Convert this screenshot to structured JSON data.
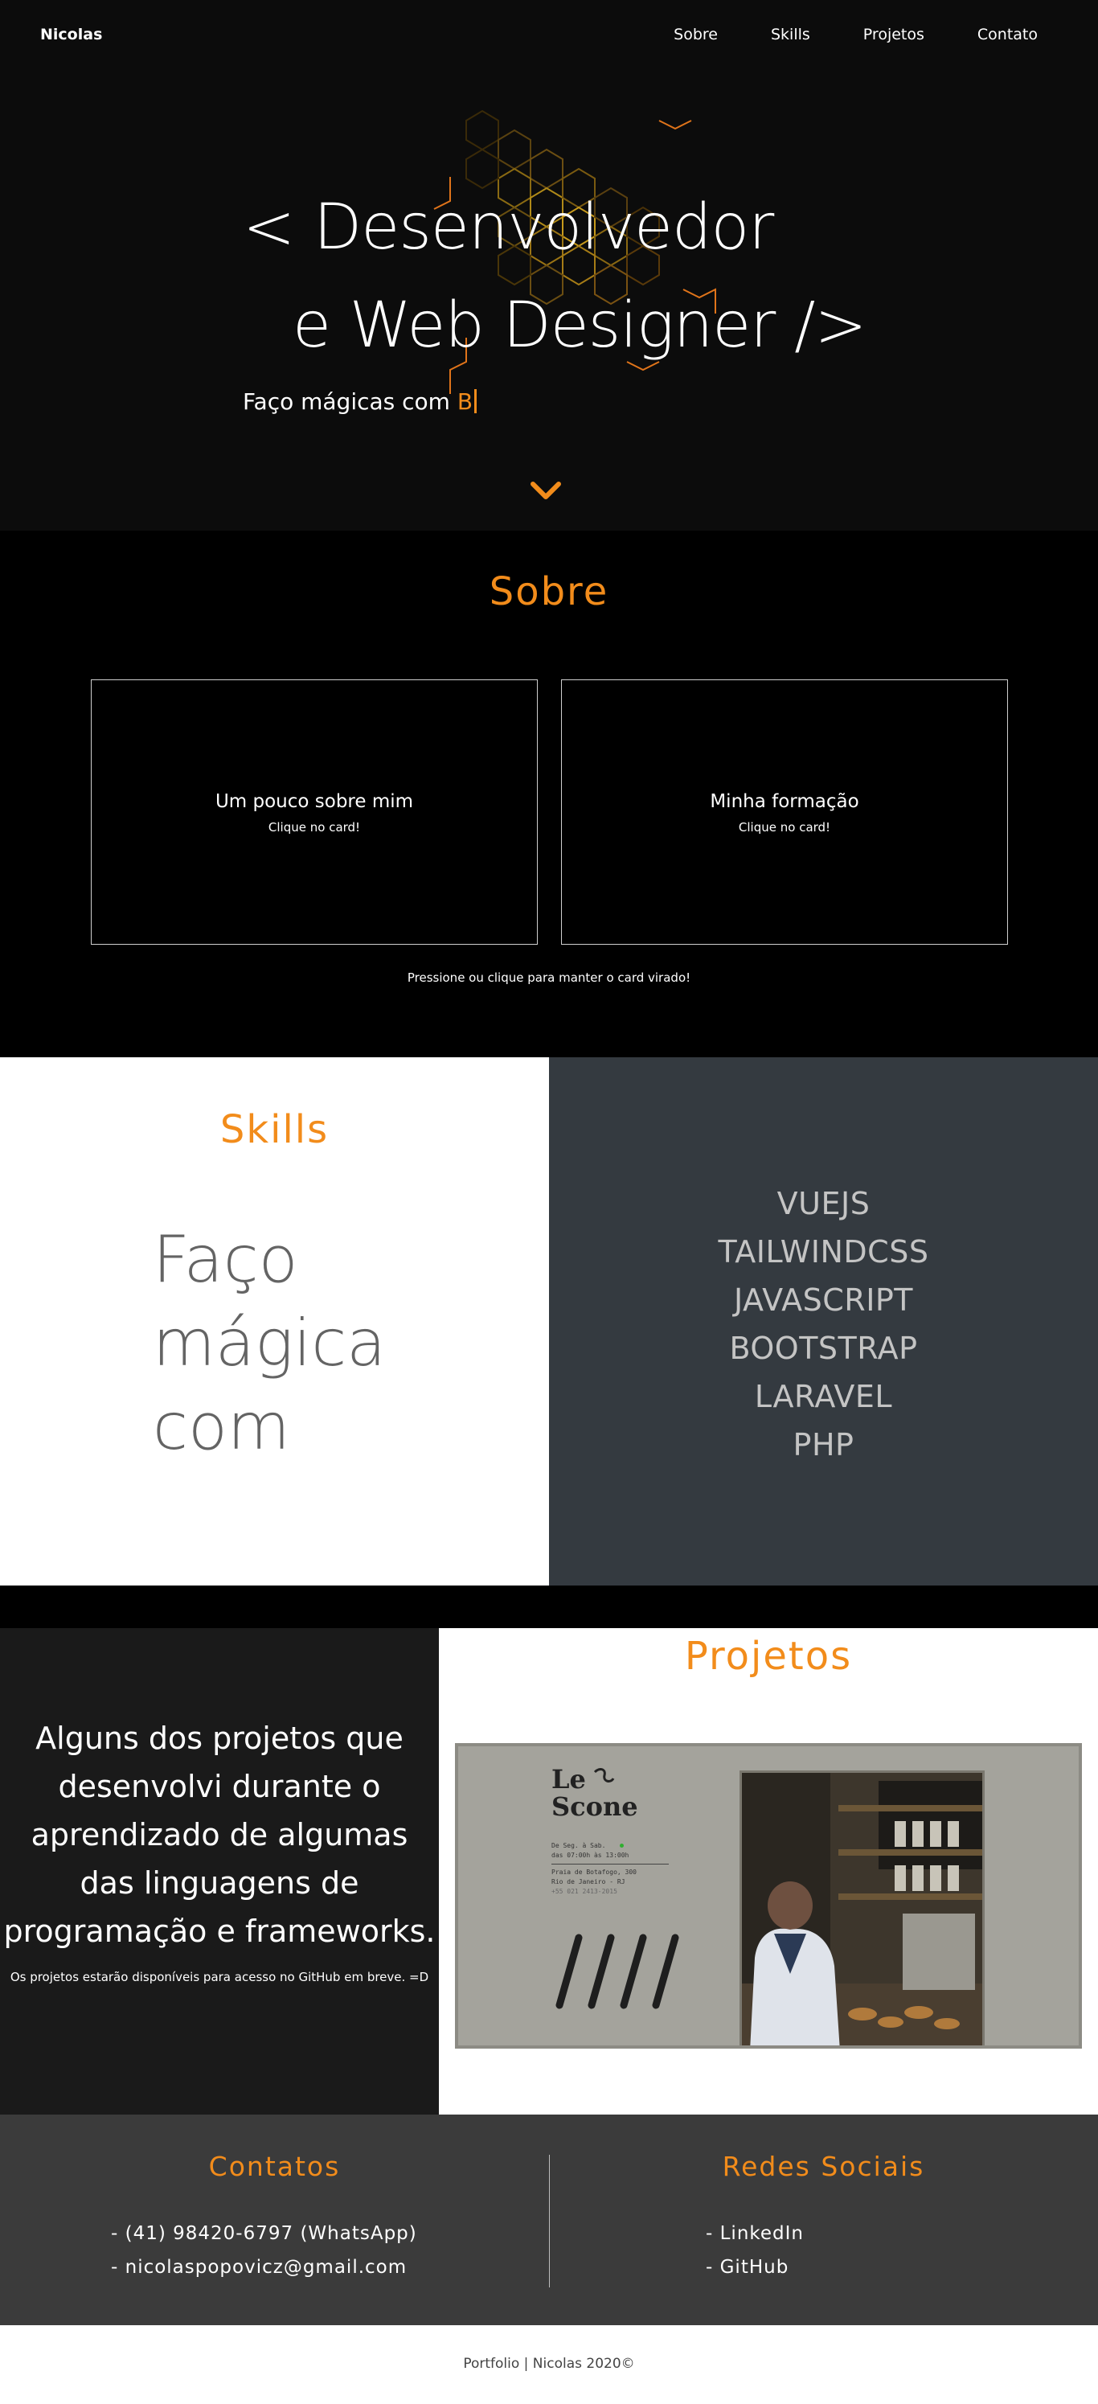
{
  "nav": {
    "brand": "Nicolas",
    "links": [
      "Sobre",
      "Skills",
      "Projetos",
      "Contato"
    ]
  },
  "hero": {
    "line1": "< Desenvolvedor",
    "line2": "e Web Designer />",
    "subtitle_prefix": "Faço mágicas com ",
    "subtitle_highlight": "B",
    "scroll_icon": "chevron-down-icon"
  },
  "sobre": {
    "title": "Sobre",
    "cards": [
      {
        "title": "Um pouco sobre mim",
        "subtitle": "Clique no card!"
      },
      {
        "title": "Minha formação",
        "subtitle": "Clique no card!"
      }
    ],
    "hint": "Pressione ou clique para manter o card virado!"
  },
  "skills": {
    "title": "Skills",
    "magic_text": "Faço mágica com",
    "list": [
      "VUEJS",
      "TAILWINDCSS",
      "JAVASCRIPT",
      "BOOTSTRAP",
      "LARAVEL",
      "PHP"
    ]
  },
  "projetos": {
    "title": "Projetos",
    "description": "Alguns dos projetos que desenvolvi durante o aprendizado de algumas das linguagens de programação e frameworks.",
    "note": "Os projetos estarão disponíveis para acesso no GitHub em breve. =D",
    "project": {
      "logo_line1": "Le",
      "logo_line2": "Scone",
      "info_line1": "De Seg. à Sab.",
      "info_line2": "das 07:00h às 13:00h",
      "info_line3": "Praia de Botafogo, 300",
      "info_line4": "Rio de Janeiro - RJ",
      "info_line5": "+55 021 2413-2015"
    }
  },
  "contatos": {
    "title": "Contatos",
    "items": [
      "- (41) 98420-6797 (WhatsApp)",
      "- nicolaspopovicz@gmail.com"
    ]
  },
  "redes": {
    "title": "Redes Sociais",
    "items": [
      "- LinkedIn",
      "- GitHub"
    ]
  },
  "footer": {
    "text": "Portfolio | Nicolas 2020©"
  },
  "colors": {
    "accent": "#f28c1b",
    "hero_bg": "#0c0c0c",
    "skills_panel": "#343a40",
    "projects_panel": "#1a1a1a",
    "contact_bg": "#3b3b3b"
  }
}
